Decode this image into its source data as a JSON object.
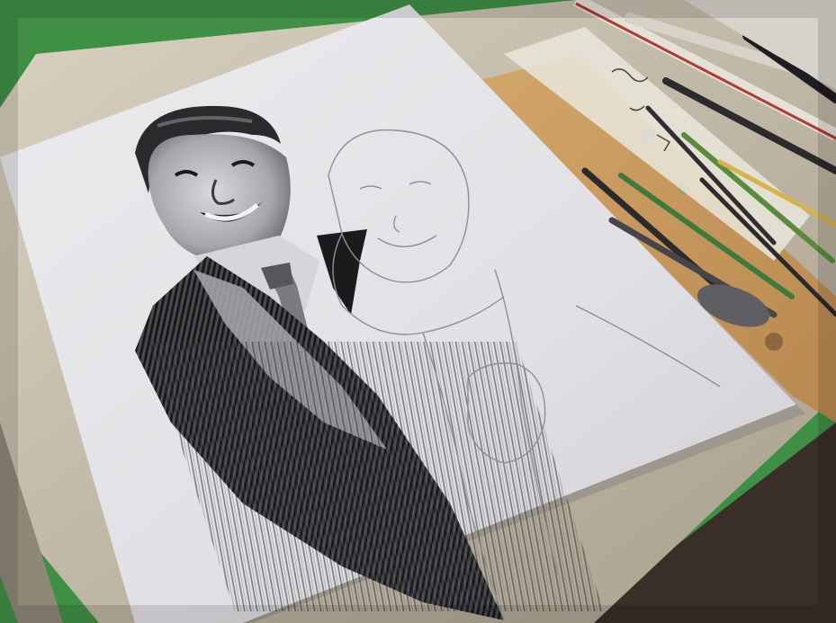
{
  "scene": {
    "subject": "pencil-portrait-drawing-in-progress",
    "colors": {
      "wall_green": "#3f8f45",
      "desk": "#cfc7b4",
      "board": "#c99a5c",
      "paper": "#e6e5e8",
      "graphite_dark": "#1e1e22",
      "skin_shade": "#8a8a8e",
      "pencil_black": "#2b2b2e",
      "pencil_green": "#3e7a3c",
      "ruler_red": "#b23a34",
      "floor_dark": "#3a2e28"
    }
  }
}
